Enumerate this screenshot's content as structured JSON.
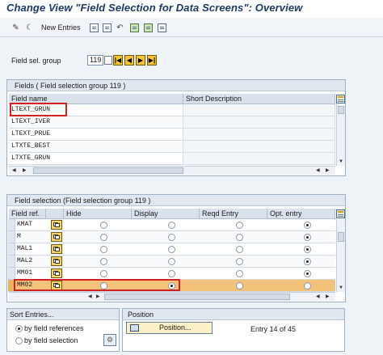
{
  "title": "Change View \"Field Selection for Data Screens\": Overview",
  "toolbar": {
    "new_entries": "New Entries"
  },
  "field_sel_group": {
    "label": "Field sel. group",
    "value": "119"
  },
  "fields_panel": {
    "header": "Fields",
    "subheader": "( Field selection group 119 )",
    "columns": [
      "Field name",
      "Short Description"
    ],
    "rows": [
      {
        "name": "LTEXT_GRUN",
        "desc": ""
      },
      {
        "name": "LTEXT_IVER",
        "desc": ""
      },
      {
        "name": "LTEXT_PRUE",
        "desc": ""
      },
      {
        "name": "LTXTE_BEST",
        "desc": ""
      },
      {
        "name": "LTXTE_GRUN",
        "desc": ""
      }
    ]
  },
  "selection_panel": {
    "header": "Field selection (Field selection group 119 )",
    "columns": [
      "Field ref.",
      "Hide",
      "Display",
      "Reqd Entry",
      "Opt. entry"
    ],
    "rows": [
      {
        "ref": "KMAT",
        "selected": "opt"
      },
      {
        "ref": "M",
        "selected": "opt"
      },
      {
        "ref": "MAL1",
        "selected": "opt"
      },
      {
        "ref": "MAL2",
        "selected": "opt"
      },
      {
        "ref": "MM01",
        "selected": "opt"
      },
      {
        "ref": "MM02",
        "selected": "display"
      }
    ]
  },
  "sort_panel": {
    "header": "Sort Entries...",
    "options": [
      "by field references",
      "by field selection"
    ],
    "selected": 0
  },
  "position_panel": {
    "header": "Position",
    "button_label": "Position...",
    "entry_text": "Entry 14 of 45"
  },
  "colors": {
    "highlight_row": "#f2c27a",
    "annotation_red": "#d32121",
    "title_blue": "#1e3a66"
  }
}
